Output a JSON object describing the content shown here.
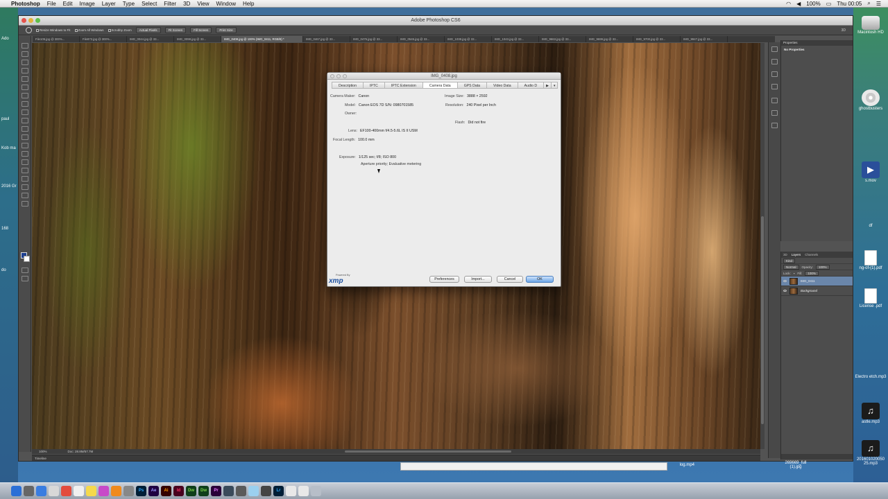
{
  "menubar": {
    "app": "Photoshop",
    "items": [
      "File",
      "Edit",
      "Image",
      "Layer",
      "Type",
      "Select",
      "Filter",
      "3D",
      "View",
      "Window",
      "Help"
    ],
    "clock": "Thu 00:05",
    "battery": "100%"
  },
  "window": {
    "title": "Adobe Photoshop CS6"
  },
  "options": {
    "resize_windows": "Resize Windows to Fit",
    "zoom_all": "Zoom All Windows",
    "scrubby": "Scrubby Zoom",
    "actual_pixels": "Actual Pixels",
    "fit_screen": "Fit Screen",
    "fill_screen": "Fill Screen",
    "print_size": "Print Size",
    "workspace": "3D"
  },
  "tabs": [
    {
      "label": "File105.jpg @ 300%..."
    },
    {
      "label": "File872.jpg @ 300%..."
    },
    {
      "label": "IMG_0044.jpg @ 33..."
    },
    {
      "label": "IMG_0098.jpg @ 33..."
    },
    {
      "label": "IMG_0408.jpg @ 100% (IMG_0411, RGB/8) *",
      "active": true
    },
    {
      "label": "IMG_0467.jpg @ 33..."
    },
    {
      "label": "IMG_0475.jpg @ 33..."
    },
    {
      "label": "IMG_0545.jpg @ 33..."
    },
    {
      "label": "IMG_1038.jpg @ 33..."
    },
    {
      "label": "IMG_1043.jpg @ 33..."
    },
    {
      "label": "IMG_9663.jpg @ 33..."
    },
    {
      "label": "IMG_9699.jpg @ 33..."
    },
    {
      "label": "IMG_9700.jpg @ 33..."
    },
    {
      "label": "IMG_9947.jpg @ 33..."
    }
  ],
  "status": {
    "zoom": "100%",
    "doc": "Doc: 28.8M/57.7M",
    "timeline": "Timeline"
  },
  "properties": {
    "header": "Properties",
    "empty": "No Properties"
  },
  "layers_panel": {
    "tabs": [
      "3D",
      "Layers",
      "Channels"
    ],
    "kind": "Kind",
    "mode": "Normal",
    "opacity_label": "Opacity:",
    "opacity": "100%",
    "lock_label": "Lock:",
    "fill_label": "Fill:",
    "fill": "100%",
    "layers": [
      {
        "name": "IMG_0411",
        "selected": true
      },
      {
        "name": "Background",
        "selected": false
      }
    ]
  },
  "dialog": {
    "title": "IMG_0408.jpg",
    "tabs": [
      "Description",
      "IPTC",
      "IPTC Extension",
      "Camera Data",
      "GPS Data",
      "Video Data",
      "Audio D"
    ],
    "active_tab": "Camera Data",
    "camera_maker_label": "Camera Maker:",
    "camera_maker": "Canon",
    "model_label": "Model:",
    "model": "Canon EOS 7D  S/N: 0980701585",
    "owner_label": "Owner:",
    "owner": "",
    "image_size_label": "Image Size:",
    "image_size": "3888 × 2592",
    "resolution_label": "Resolution:",
    "resolution": "240 Pixel per Inch",
    "flash_label": "Flash:",
    "flash": "Did not fire",
    "lens_label": "Lens:",
    "lens": "EF100-400mm f/4.5-5.6L IS II USM",
    "focal_label": "Focal Length:",
    "focal": "100.0 mm",
    "exposure_label": "Exposure:",
    "exposure": "1/125 sec;   f/8;   ISO 800",
    "exposure_line2": "Aperture priority;    Evaluative metering",
    "powered_by": "Powered By",
    "xmp": "xmp",
    "buttons": {
      "preferences": "Preferences",
      "import": "Import...",
      "cancel": "Cancel",
      "ok": "OK"
    }
  },
  "desktop": {
    "hd": "Macintosh HD",
    "cd": "ghostbusters",
    "mov": "s.mov",
    "pdf1": "df",
    "pdf2": "ng-of-(1).pdf",
    "pdf3": "License .pdf",
    "mp3a": "Electro etch.mp3",
    "mp3b": "astle.mp3",
    "mp3c": "201601020050 25.mp3",
    "mp3d": "269669_full (1).jpg",
    "mp4": "log.mp4",
    "left_labels": [
      "Ado",
      "paul",
      "Kob ma",
      "2016 Gr",
      "168",
      "do"
    ]
  },
  "dock": {
    "apps": [
      "Ps",
      "Ae",
      "Ai",
      "Id",
      "Dw",
      "Dw",
      "Pr",
      "Lr"
    ]
  }
}
